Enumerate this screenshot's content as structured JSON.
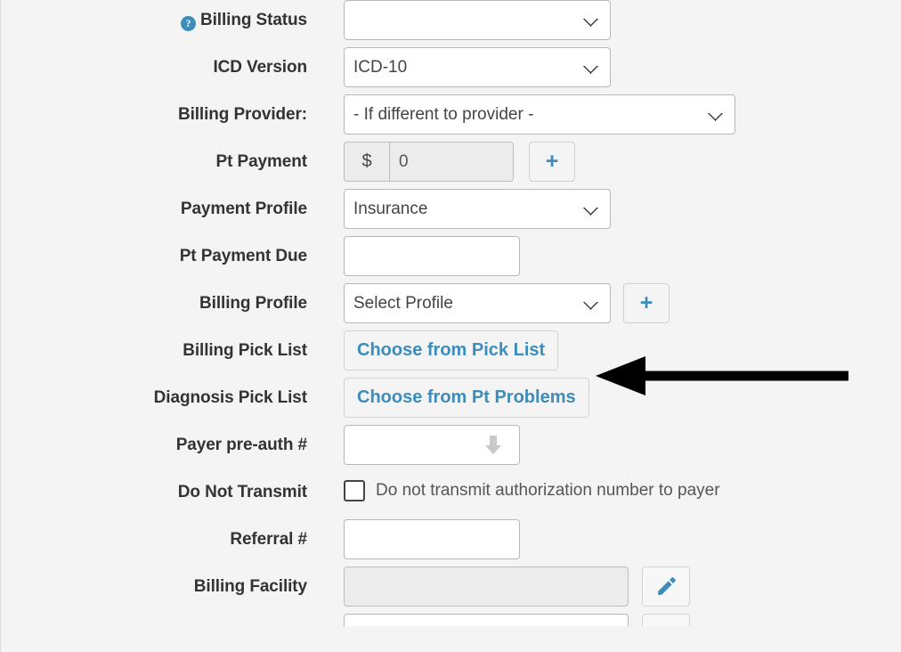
{
  "colors": {
    "page_background": "#f4f4f4",
    "label_text": "#333333",
    "link_blue": "#3c8dbc",
    "help_icon_blue": "#3c8dbc",
    "input_border": "#b7b7b7",
    "disabled_fill": "#ececec",
    "annotation_arrow": "#000000"
  },
  "form": {
    "rows": [
      {
        "id": "billing-status",
        "label": "Billing Status",
        "has_help_icon": true,
        "help_icon": "question-circle-icon",
        "control": "select",
        "value": ""
      },
      {
        "id": "icd-version",
        "label": "ICD Version",
        "has_help_icon": false,
        "control": "select",
        "value": "ICD-10"
      },
      {
        "id": "billing-provider",
        "label": "Billing Provider:",
        "has_help_icon": false,
        "control": "select",
        "value": "- If different to provider -"
      },
      {
        "id": "pt-payment",
        "label": "Pt Payment",
        "has_help_icon": false,
        "control": "currency-input-group",
        "addon": "$",
        "value": "0",
        "add_button": "+"
      },
      {
        "id": "payment-profile",
        "label": "Payment Profile",
        "has_help_icon": false,
        "control": "select",
        "value": "Insurance"
      },
      {
        "id": "pt-payment-due",
        "label": "Pt Payment Due",
        "has_help_icon": false,
        "control": "text",
        "value": ""
      },
      {
        "id": "billing-profile",
        "label": "Billing Profile",
        "has_help_icon": false,
        "control": "select-with-add",
        "value": "Select Profile",
        "add_button": "+"
      },
      {
        "id": "billing-pick-list",
        "label": "Billing Pick List",
        "has_help_icon": false,
        "control": "link-button",
        "button_label": "Choose from Pick List"
      },
      {
        "id": "diagnosis-pick-list",
        "label": "Diagnosis Pick List",
        "has_help_icon": false,
        "control": "link-button",
        "button_label": "Choose from Pt Problems"
      },
      {
        "id": "payer-pre-auth",
        "label": "Payer pre-auth #",
        "has_help_icon": false,
        "control": "text-with-arrow",
        "value": "",
        "arrow_icon": "arrow-down-icon"
      },
      {
        "id": "do-not-transmit",
        "label": "Do Not Transmit",
        "has_help_icon": false,
        "control": "checkbox",
        "checked": false,
        "checkbox_label": "Do not transmit authorization number to payer"
      },
      {
        "id": "referral-number",
        "label": "Referral #",
        "has_help_icon": false,
        "control": "text",
        "value": ""
      },
      {
        "id": "billing-facility",
        "label": "Billing Facility",
        "has_help_icon": false,
        "control": "text-with-edit",
        "value": "",
        "edit_icon": "pencil-icon"
      }
    ]
  },
  "annotation": {
    "type": "arrow",
    "direction": "left",
    "points_to": "Choose from Pick List",
    "color": "#000000"
  }
}
